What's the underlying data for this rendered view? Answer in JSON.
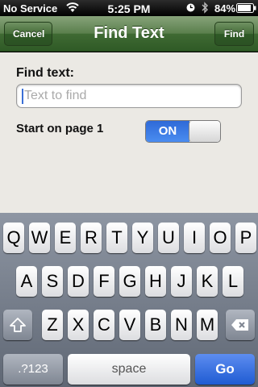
{
  "status_bar": {
    "carrier": "No Service",
    "time": "5:25 PM",
    "battery": "84%"
  },
  "nav_bar": {
    "title": "Find Text",
    "cancel_label": "Cancel",
    "find_label": "Find"
  },
  "form": {
    "find_label": "Find text:",
    "find_value": "",
    "find_placeholder": "Text to find",
    "start_label": "Start on page 1",
    "toggle_label": "ON",
    "toggle_state": "on"
  },
  "keyboard": {
    "row1": [
      "Q",
      "W",
      "E",
      "R",
      "T",
      "Y",
      "U",
      "I",
      "O",
      "P"
    ],
    "row2": [
      "A",
      "S",
      "D",
      "F",
      "G",
      "H",
      "J",
      "K",
      "L"
    ],
    "row3": [
      "Z",
      "X",
      "C",
      "V",
      "B",
      "N",
      "M"
    ],
    "numbers_label": ".?123",
    "space_label": "space",
    "go_label": "Go"
  },
  "icons": {
    "wifi": "wifi-icon",
    "clock": "clock-icon",
    "bluetooth": "bluetooth-icon",
    "battery": "battery-icon",
    "shift": "shift-icon",
    "delete": "delete-icon"
  },
  "colors": {
    "nav_green": "#4a7440",
    "toggle_blue": "#2f6ad8",
    "go_blue": "#1f5bd2"
  }
}
